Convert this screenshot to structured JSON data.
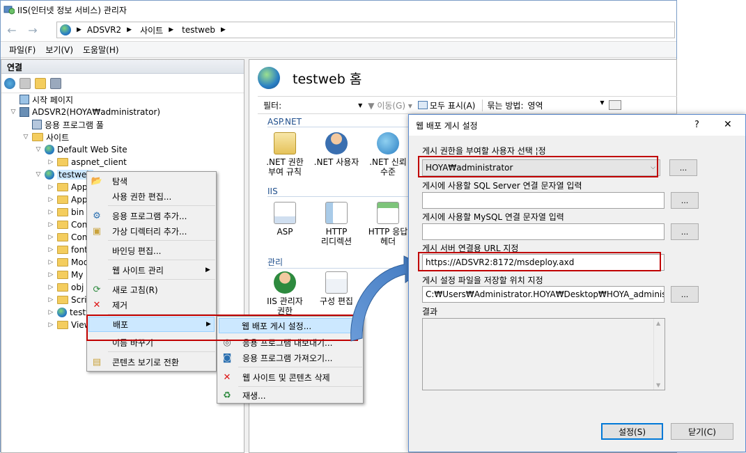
{
  "window": {
    "title": "IIS(인터넷 정보 서비스) 관리자",
    "breadcrumbs": [
      "ADSVR2",
      "사이트",
      "testweb"
    ]
  },
  "menu": [
    "파일(F)",
    "보기(V)",
    "도움말(H)"
  ],
  "connections": {
    "header": "연결",
    "tree": {
      "start_page": "시작 페이지",
      "server": "ADSVR2(HOYA₩administrator)",
      "app_pools": "응용 프로그램 풀",
      "sites": "사이트",
      "default_site": "Default Web Site",
      "aspnet_client": "aspnet_client",
      "testweb": "testweb",
      "children": [
        "App",
        "App",
        "bin",
        "Con",
        "Con",
        "font",
        "Mod",
        "My",
        "obj",
        "Scri",
        "testw",
        "View"
      ]
    }
  },
  "home": {
    "title": "testweb 홈",
    "filter_label": "필터:",
    "go_label": "이동(G)",
    "show_all_label": "모두 표시(A)",
    "group_label": "묶는 방법:",
    "group_value": "영역"
  },
  "sections": {
    "aspnet": {
      "title": "ASP.NET",
      "features": [
        ".NET 권한\n부여 규칙",
        ".NET 사용자",
        ".NET 신뢰\n수준"
      ]
    },
    "iis": {
      "title": "IIS",
      "features": [
        "ASP",
        "HTTP\n리디렉션",
        "HTTP 응답\n헤더"
      ]
    },
    "management": {
      "title": "관리",
      "features": [
        "IIS 관리자\n권한",
        "구성 편집"
      ]
    }
  },
  "context_menu": {
    "items": [
      "탐색",
      "사용 권한 편집...",
      "응용 프로그램 추가...",
      "가상 디렉터리 추가...",
      "바인딩 편집...",
      "웹 사이트 관리",
      "새로 고침(R)",
      "제거",
      "배포",
      "이름 바꾸기",
      "콘텐츠 보기로 전환"
    ]
  },
  "deploy_menu": {
    "items": [
      "웹 배포 게시 설정...",
      "응용 프로그램 내보내기...",
      "응용 프로그램 가져오기...",
      "웹 사이트 및 콘텐츠 삭제",
      "재생..."
    ]
  },
  "dialog": {
    "title": "웹 배포 게시 설정",
    "help": "?",
    "close": "✕",
    "user_label": "게시 권한을 부여할 사용자 선택 ¦정",
    "user_value": "HOYA₩administrator",
    "sql_label": "게시에 사용할 SQL Server 연결 문자열 입력",
    "sql_value": "",
    "mysql_label": "게시에 사용할 MySQL 연결 문자열 입력",
    "mysql_value": "",
    "url_label": "게시 서버 연결용 URL 지정",
    "url_value": "https://ADSVR2:8172/msdeploy.axd",
    "path_label": "게시 설정 파일을 저장할 위치 지정",
    "path_value": "C:₩Users₩Administrator.HOYA₩Desktop₩HOYA_administrator_",
    "result_label": "결과",
    "browse": "...",
    "ok": "설정(S)",
    "cancel": "닫기(C)"
  }
}
